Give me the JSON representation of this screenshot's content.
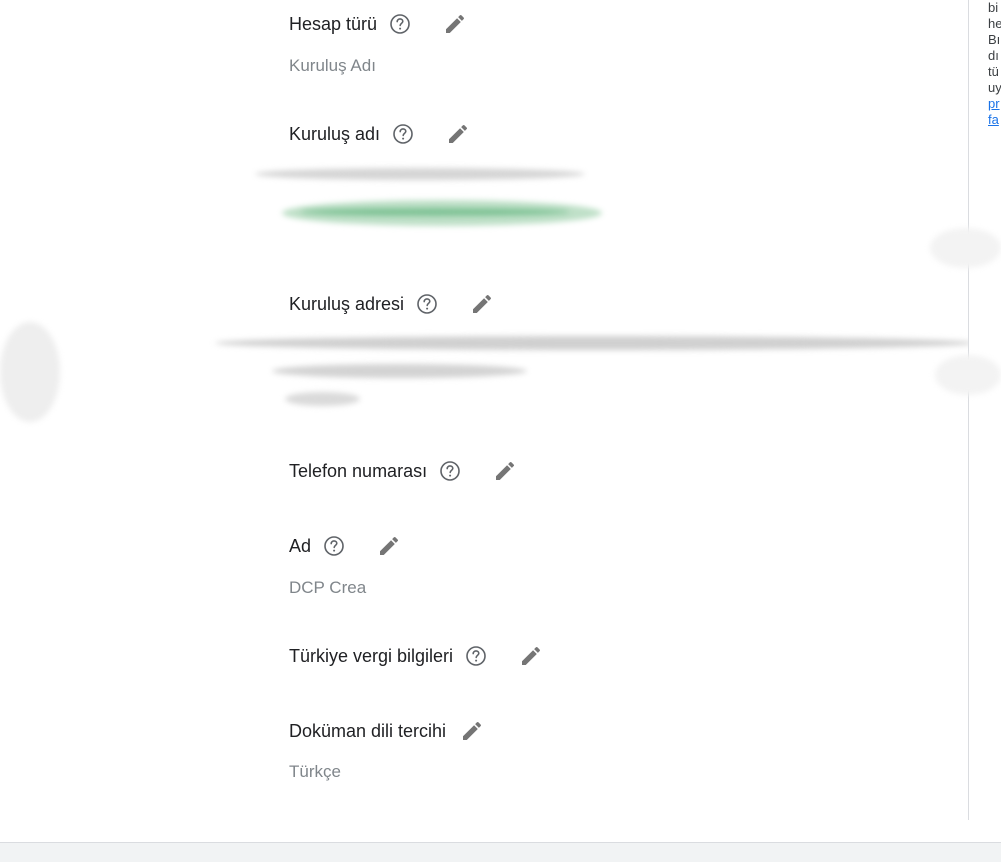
{
  "fields": {
    "account_type": {
      "label": "Hesap türü",
      "value": "Kuruluş Adı"
    },
    "org_name": {
      "label": "Kuruluş adı"
    },
    "org_address": {
      "label": "Kuruluş adresi"
    },
    "phone": {
      "label": "Telefon numarası"
    },
    "name": {
      "label": "Ad",
      "value": "DCP Crea"
    },
    "tax": {
      "label": "Türkiye vergi bilgileri"
    },
    "doc_lang": {
      "label": "Doküman dili tercihi",
      "value": "Türkçe"
    }
  },
  "side_panel": {
    "lines": [
      "bi",
      "he",
      "Bı",
      "dı",
      "tü",
      "uy"
    ],
    "links": [
      "pr",
      "fa"
    ]
  },
  "icons": {
    "help": "help-circle-icon",
    "edit": "pencil-icon"
  },
  "colors": {
    "icon": "#757575",
    "label": "#202124",
    "value": "#80868b",
    "link": "#1a73e8"
  }
}
